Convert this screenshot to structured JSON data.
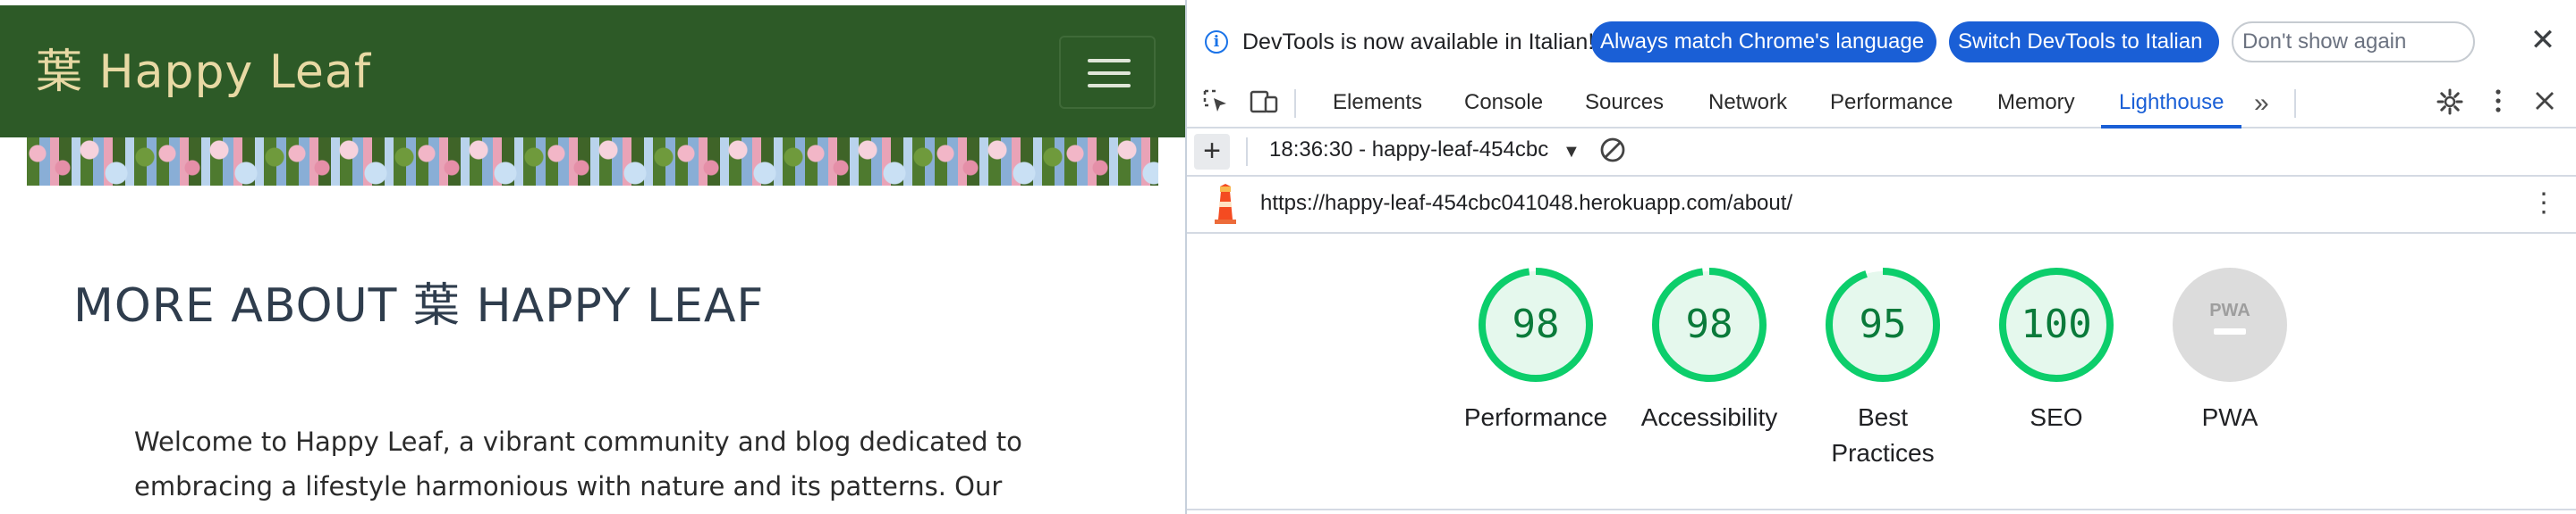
{
  "site": {
    "brand": "葉 Happy Leaf",
    "heading": "MORE ABOUT 葉 HAPPY LEAF",
    "intro_line1": "Welcome to Happy Leaf, a vibrant community and blog dedicated to",
    "intro_line2": "embracing a lifestyle harmonious with nature and its patterns. Our"
  },
  "devtools": {
    "infobar": {
      "icon": "info-icon",
      "icon_glyph": "i",
      "message": "DevTools is now available in Italian!",
      "match_label": "Always match Chrome's language",
      "switch_label": "Switch DevTools to Italian",
      "dont_show_label": "Don't show again",
      "close_glyph": "✕"
    },
    "tabs": [
      "Elements",
      "Console",
      "Sources",
      "Network",
      "Performance",
      "Memory",
      "Lighthouse"
    ],
    "active_tab": "Lighthouse",
    "more_tabs_glyph": "»",
    "report": {
      "selected": "18:36:30 - happy-leaf-454cbc",
      "add_glyph": "+",
      "url": "https://happy-leaf-454cbc041048.herokuapp.com/about/"
    },
    "scores": [
      {
        "label_lines": [
          "Performance"
        ],
        "value": "98",
        "fraction": 0.98
      },
      {
        "label_lines": [
          "Accessibility"
        ],
        "value": "98",
        "fraction": 0.98
      },
      {
        "label_lines": [
          "Best",
          "Practices"
        ],
        "value": "95",
        "fraction": 0.95
      },
      {
        "label_lines": [
          "SEO"
        ],
        "value": "100",
        "fraction": 1.0
      },
      {
        "label_lines": [
          "PWA"
        ],
        "value": "PWA",
        "fraction": 0,
        "type": "pwa"
      }
    ],
    "colors": {
      "pass_ring": "#0cce6b",
      "pass_fill": "#e5f8ed",
      "pass_text": "#0a7a3a",
      "pwa_fill": "#dcdcdc",
      "accent": "#1a5fd6",
      "site_nav": "#2d5a27",
      "brand_text": "#e8d9a4"
    }
  }
}
